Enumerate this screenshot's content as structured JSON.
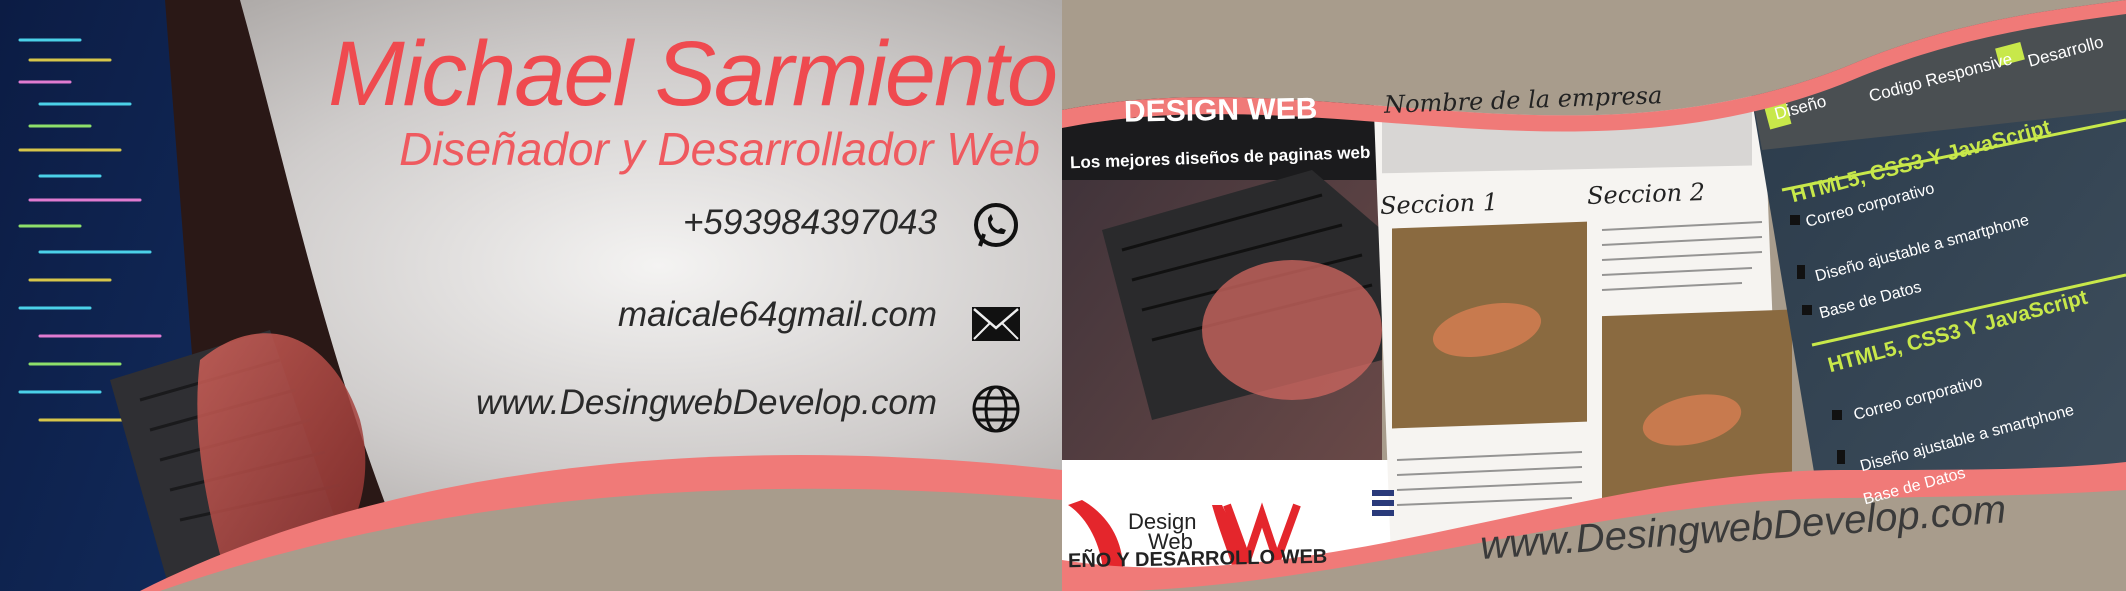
{
  "card_front": {
    "name_first": "Michael",
    "name_last": "Sarmiento",
    "role": "Diseñador y Desarrollador Web",
    "phone": "+593984397043",
    "email": "maicale64gmail.com",
    "website": "www.DesingwebDevelop.com"
  },
  "card_back": {
    "website": "www.DesingwebDevelop.com",
    "mockup": {
      "banner_title": "DESIGN WEB",
      "banner_sub": "Los mejores diseños de paginas web",
      "company_field": "Nombre de la empresa",
      "section1": "Seccion 1",
      "section2": "Seccion 2",
      "logo_text_1": "Design",
      "logo_text_2": "Web",
      "logo_tagline": "EÑO Y DESARROLLO WEB",
      "nav": [
        "Diseño",
        "Codigo Responsive",
        "Desarrollo"
      ],
      "features_title": "HTML5, CSS3 Y JavaScript",
      "features": [
        "Correo corporativo",
        "Diseño ajustable a smartphone",
        "Base de Datos"
      ]
    }
  },
  "colors": {
    "accent_red": "#ef4a4f",
    "wave_pink": "#f07a78",
    "taupe": "#a89c8c",
    "lime": "#c8e84a"
  }
}
